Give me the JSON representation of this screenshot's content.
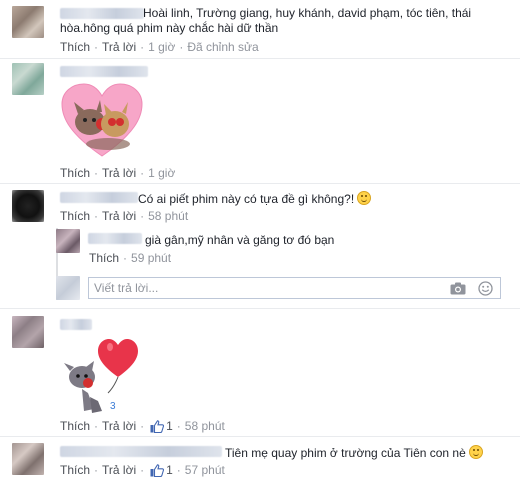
{
  "comments": [
    {
      "text_line1": "Hoài linh, Trường giang, huy khánh, david phạm, tóc tiên, thái",
      "text_line2": "hòa.hông quá phim này chắc hài dữ thần",
      "like": "Thích",
      "reply": "Trả lời",
      "time": "1 giờ",
      "edited": "Đã chỉnh sửa"
    },
    {
      "sticker": "cats-heart-sticker",
      "like": "Thích",
      "reply": "Trả lời",
      "time": "1 giờ"
    },
    {
      "text": "Có ai piết phim này có tựa đề gì không?!",
      "like": "Thích",
      "reply": "Trả lời",
      "time": "58 phút",
      "replies": [
        {
          "text": "già gân,mỹ nhân và găng tơ đó bạn",
          "like": "Thích",
          "time": "59 phút"
        }
      ],
      "reply_input_placeholder": "Viết trả lời..."
    },
    {
      "sticker": "dog-balloon-sticker",
      "like": "Thích",
      "reply": "Trả lời",
      "likes": "1",
      "time": "58 phút"
    },
    {
      "text": "Tiên mẹ quay phim ở trường của Tiên con nè",
      "like": "Thích",
      "reply": "Trả lời",
      "likes": "1",
      "time": "57 phút"
    }
  ],
  "colors": {
    "link": "#4b4f56",
    "meta": "#90949c",
    "like_blue": "#4267b2",
    "heart": "#e8344a"
  }
}
